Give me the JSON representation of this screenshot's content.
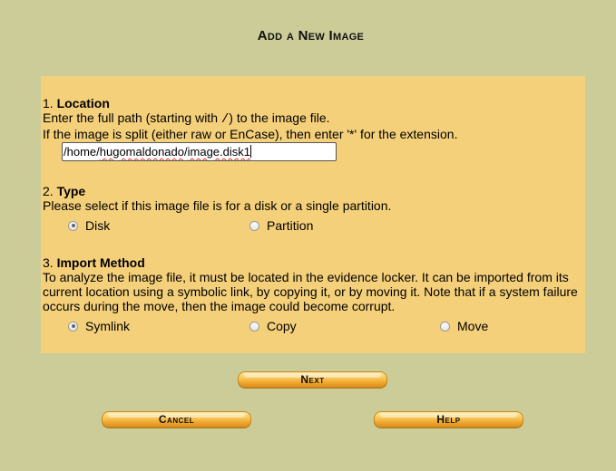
{
  "page": {
    "title": "Add a New Image"
  },
  "location": {
    "number": "1.",
    "heading": "Location",
    "line1_prefix": "Enter the full path (starting with ",
    "line1_code": "/",
    "line1_suffix": ") to the image file.",
    "line2": "If the image is split (either raw or EnCase), then enter '*' for the extension.",
    "path_part1": "/home/",
    "path_part2": "hugomaldonado",
    "path_part3": "/",
    "path_part4": "image.disk1"
  },
  "type": {
    "number": "2.",
    "heading": "Type",
    "description": "Please select if this image file is for a disk or a single partition.",
    "options": [
      {
        "label": "Disk",
        "selected": true
      },
      {
        "label": "Partition",
        "selected": false
      }
    ]
  },
  "import": {
    "number": "3.",
    "heading": "Import Method",
    "description_line1": "To analyze the image file, it must be located in the evidence locker. It can be imported from its",
    "description_line2": "current location using a symbolic link, by copying it, or by moving it. Note that if a system failure",
    "description_line3": "occurs during the move, then the image could become corrupt.",
    "options": [
      {
        "label": "Symlink",
        "selected": true
      },
      {
        "label": "Copy",
        "selected": false
      },
      {
        "label": "Move",
        "selected": false
      }
    ]
  },
  "buttons": {
    "next": "Next",
    "cancel": "Cancel",
    "help": "Help"
  },
  "colors": {
    "background": "#cccc99",
    "panel": "#f5d07a",
    "button": "#f8c75a"
  }
}
